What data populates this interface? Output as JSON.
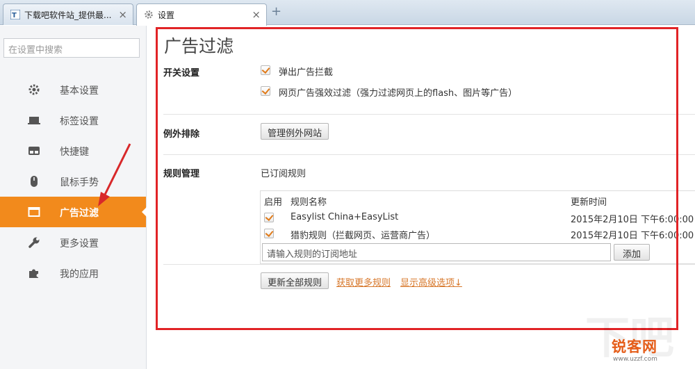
{
  "tabs": [
    {
      "title": "下载吧软件站_提供最...",
      "close": "×",
      "icon": "site-favicon"
    },
    {
      "title": "设置",
      "close": "×",
      "icon": "gear-icon"
    }
  ],
  "new_tab": "+",
  "sidebar": {
    "search_placeholder": "在设置中搜索",
    "items": [
      {
        "label": "基本设置",
        "icon": "gear-icon"
      },
      {
        "label": "标签设置",
        "icon": "tab-icon"
      },
      {
        "label": "快捷键",
        "icon": "keyboard-icon"
      },
      {
        "label": "鼠标手势",
        "icon": "mouse-icon"
      },
      {
        "label": "广告过滤",
        "icon": "window-icon",
        "active": true
      },
      {
        "label": "更多设置",
        "icon": "wrench-icon"
      },
      {
        "label": "我的应用",
        "icon": "puzzle-icon"
      }
    ]
  },
  "main": {
    "title": "广告过滤",
    "switch_section": {
      "label": "开关设置",
      "options": [
        {
          "text": "弹出广告拦截",
          "checked": true
        },
        {
          "text": "网页广告强效过滤（强力过滤网页上的flash、图片等广告）",
          "checked": true
        }
      ]
    },
    "exception_section": {
      "label": "例外排除",
      "button": "管理例外网站"
    },
    "rules_section": {
      "label": "规则管理",
      "subtitle": "已订阅规则",
      "columns": [
        "启用",
        "规则名称",
        "更新时间"
      ],
      "rows": [
        {
          "enabled": true,
          "name": "Easylist China+EasyList",
          "updated": "2015年2月10日 下午6:00:00"
        },
        {
          "enabled": true,
          "name": "猎豹规则（拦截网页、运营商广告）",
          "updated": "2015年2月10日 下午6:00:00"
        }
      ],
      "url_input_placeholder": "请输入规则的订阅地址",
      "add_button": "添加",
      "update_button": "更新全部规则",
      "more_rules_link": "获取更多规则",
      "advanced_link": "显示高级选项↓"
    }
  },
  "watermark": {
    "main": "锐客网",
    "sub": "www.uzzf.com"
  },
  "colors": {
    "accent": "#f28a1c",
    "highlight": "#e12326",
    "link": "#d7772a"
  }
}
